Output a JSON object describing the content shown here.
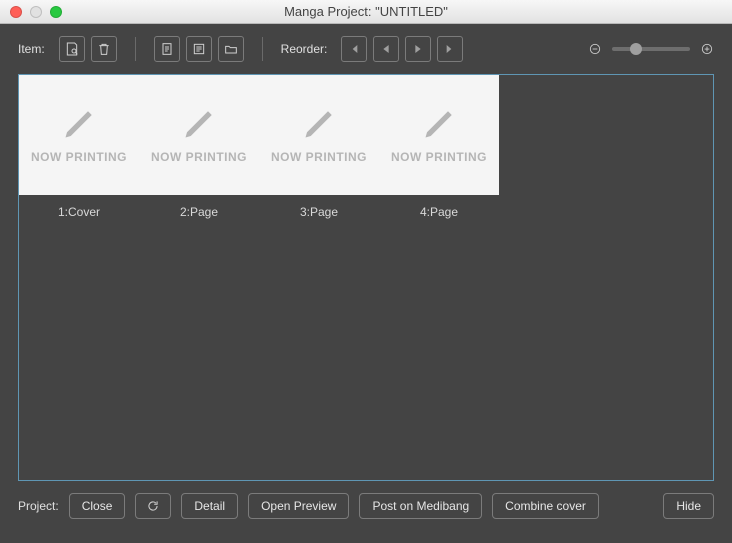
{
  "window": {
    "title": "Manga Project: \"UNTITLED\""
  },
  "toolbar": {
    "item_label": "Item:",
    "reorder_label": "Reorder:"
  },
  "pages": [
    {
      "placeholder": "NOW PRINTING",
      "label": "1:Cover"
    },
    {
      "placeholder": "NOW PRINTING",
      "label": "2:Page"
    },
    {
      "placeholder": "NOW PRINTING",
      "label": "3:Page"
    },
    {
      "placeholder": "NOW PRINTING",
      "label": "4:Page"
    }
  ],
  "bottom": {
    "project_label": "Project:",
    "close": "Close",
    "detail": "Detail",
    "open_preview": "Open Preview",
    "post": "Post on Medibang",
    "combine": "Combine cover",
    "hide": "Hide"
  }
}
